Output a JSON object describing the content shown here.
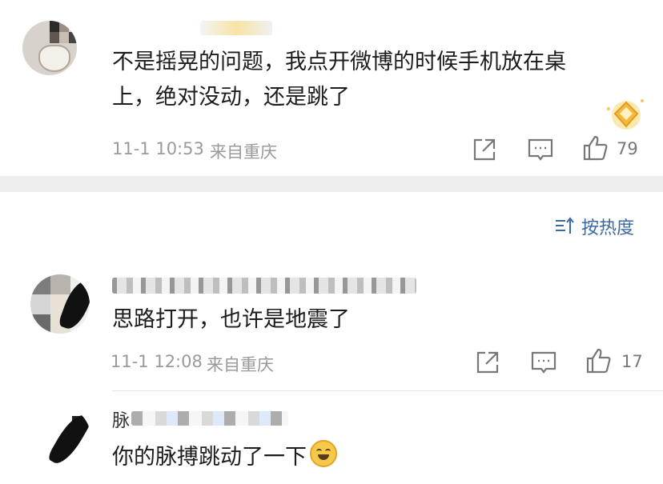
{
  "comments": [
    {
      "text_line1": "不是摇晃的问题，我点开微博的时候手机放在桌",
      "text_line2": "上，绝对没动，还是跳了",
      "time": "11-1 10:53",
      "location": "来自重庆",
      "likes": "79"
    },
    {
      "text": "思路打开，也许是地震了",
      "time": "11-1 12:08",
      "location": "来自重庆",
      "likes": "17"
    },
    {
      "username_partial": "脉",
      "text": "你的脉搏跳动了一下"
    }
  ],
  "sort": {
    "label": "按热度"
  },
  "icons": {
    "share": "share-icon",
    "comment": "comment-icon",
    "like": "thumbs-up-icon",
    "sort": "sort-icon",
    "badge": "crown-badge-icon",
    "emoji": "laughing-crying-emoji"
  },
  "colors": {
    "accent": "#3a6aa3",
    "meta_text": "#9a9a9a",
    "separator": "#eeeeee"
  }
}
